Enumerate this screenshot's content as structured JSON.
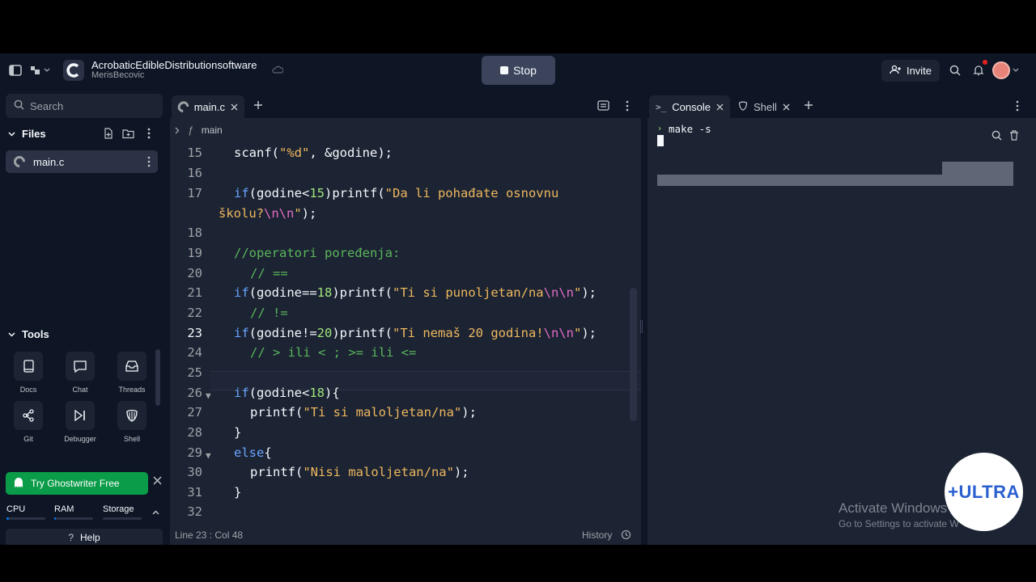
{
  "header": {
    "repl_name": "AcrobaticEdibleDistributionsoftware",
    "owner": "MerisBecovic",
    "stop_label": "Stop",
    "invite_label": "Invite"
  },
  "sidebar": {
    "search_placeholder": "Search",
    "files_heading": "Files",
    "file_name": "main.c",
    "tools_heading": "Tools",
    "tools": [
      "Docs",
      "Chat",
      "Threads",
      "Git",
      "Debugger",
      "Shell"
    ],
    "ghostwriter_label": "Try Ghostwriter Free",
    "resources": [
      "CPU",
      "RAM",
      "Storage"
    ],
    "help_label": "Help"
  },
  "editor": {
    "tab_label": "main.c",
    "breadcrumb": "main",
    "status_position": "Line 23 : Col 48",
    "history_label": "History",
    "line_numbers": [
      "15",
      "16",
      "17",
      "18",
      "19",
      "20",
      "21",
      "22",
      "23",
      "24",
      "25",
      "26",
      "27",
      "28",
      "29",
      "30",
      "31",
      "32"
    ]
  },
  "console": {
    "tab_console": "Console",
    "tab_shell": "Shell",
    "command": "make -s"
  },
  "overlay": {
    "watermark_title": "Activate Windows",
    "watermark_sub": "Go to Settings to activate W",
    "logo_text": "+ULTRA"
  },
  "colors": {
    "bg": "#0e1525",
    "panel": "#1c2333",
    "keyword": "#69a5ff",
    "string": "#eeb85e",
    "escape": "#e36dc6",
    "number": "#9fe57a",
    "comment": "#5bb65b",
    "accent_green": "#0a9c48"
  },
  "icons": [
    "sidebar-toggle-icon",
    "workspace-icon",
    "cloud-icon",
    "user-plus-icon",
    "search-icon",
    "bell-icon",
    "new-file-icon",
    "new-folder-icon",
    "more-icon",
    "close-icon",
    "plus-icon",
    "layout-icon",
    "clear-icon",
    "chevron-up-icon",
    "help-icon",
    "history-icon"
  ],
  "resource_usage": {
    "cpu": 0.05,
    "ram": 0.03,
    "storage": 0.0
  }
}
